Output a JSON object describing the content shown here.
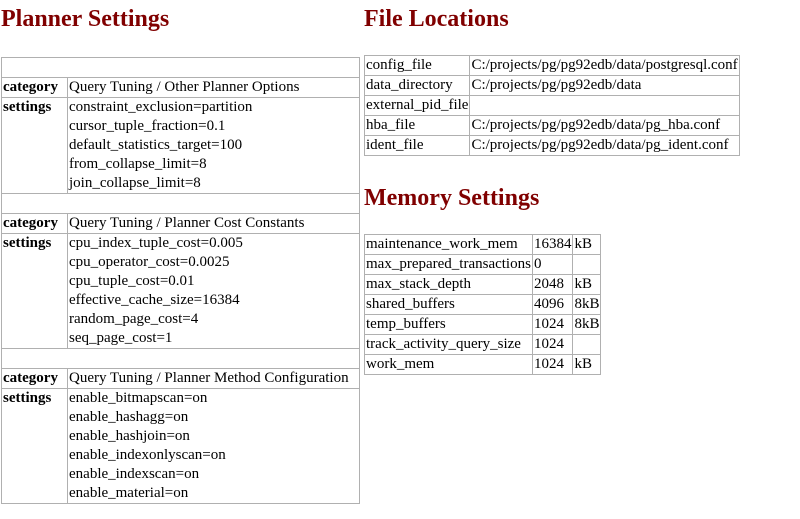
{
  "planner": {
    "title": "Planner Settings",
    "groups": [
      {
        "category_label": "category",
        "category": "Query Tuning / Other Planner Options",
        "settings_label": "settings",
        "settings": [
          "constraint_exclusion=partition",
          "cursor_tuple_fraction=0.1",
          "default_statistics_target=100",
          "from_collapse_limit=8",
          "join_collapse_limit=8"
        ]
      },
      {
        "category_label": "category",
        "category": "Query Tuning / Planner Cost Constants",
        "settings_label": "settings",
        "settings": [
          "cpu_index_tuple_cost=0.005",
          "cpu_operator_cost=0.0025",
          "cpu_tuple_cost=0.01",
          "effective_cache_size=16384",
          "random_page_cost=4",
          "seq_page_cost=1"
        ]
      },
      {
        "category_label": "category",
        "category": "Query Tuning / Planner Method Configuration",
        "settings_label": "settings",
        "settings": [
          "enable_bitmapscan=on",
          "enable_hashagg=on",
          "enable_hashjoin=on",
          "enable_indexonlyscan=on",
          "enable_indexscan=on",
          "enable_material=on"
        ]
      }
    ]
  },
  "files": {
    "title": "File Locations",
    "rows": [
      {
        "name": "config_file",
        "value": "C:/projects/pg/pg92edb/data/postgresql.conf"
      },
      {
        "name": "data_directory",
        "value": "C:/projects/pg/pg92edb/data"
      },
      {
        "name": "external_pid_file",
        "value": ""
      },
      {
        "name": "hba_file",
        "value": "C:/projects/pg/pg92edb/data/pg_hba.conf"
      },
      {
        "name": "ident_file",
        "value": "C:/projects/pg/pg92edb/data/pg_ident.conf"
      }
    ]
  },
  "memory": {
    "title": "Memory Settings",
    "rows": [
      {
        "name": "maintenance_work_mem",
        "value": "16384",
        "unit": "kB"
      },
      {
        "name": "max_prepared_transactions",
        "value": "0",
        "unit": ""
      },
      {
        "name": "max_stack_depth",
        "value": "2048",
        "unit": "kB"
      },
      {
        "name": "shared_buffers",
        "value": "4096",
        "unit": "8kB"
      },
      {
        "name": "temp_buffers",
        "value": "1024",
        "unit": "8kB"
      },
      {
        "name": "track_activity_query_size",
        "value": "1024",
        "unit": ""
      },
      {
        "name": "work_mem",
        "value": "1024",
        "unit": "kB"
      }
    ]
  }
}
